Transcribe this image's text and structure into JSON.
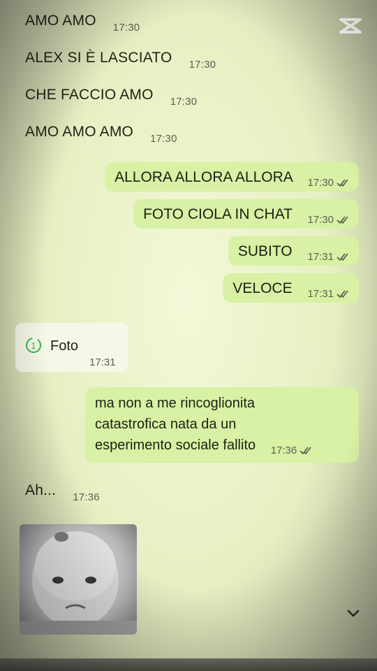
{
  "app": {
    "watermark_icon": "capcut-logo-icon"
  },
  "messages": [
    {
      "dir": "in",
      "text": "AMO AMO",
      "time": "17:30"
    },
    {
      "dir": "in",
      "text": "ALEX SI È LASCIATO",
      "time": "17:30"
    },
    {
      "dir": "in",
      "text": "CHE FACCIO AMO",
      "time": "17:30"
    },
    {
      "dir": "in",
      "text": "AMO AMO AMO",
      "time": "17:30"
    },
    {
      "dir": "out",
      "text": "ALLORA ALLORA ALLORA",
      "time": "17:30",
      "status": "read"
    },
    {
      "dir": "out",
      "text": "FOTO CIOLA IN CHAT",
      "time": "17:30",
      "status": "read"
    },
    {
      "dir": "out",
      "text": "SUBITO",
      "time": "17:31",
      "status": "read"
    },
    {
      "dir": "out",
      "text": "VELOCE",
      "time": "17:31",
      "status": "read"
    },
    {
      "dir": "in",
      "type": "view-once-photo",
      "badge": "1",
      "text": "Foto",
      "time": "17:31"
    },
    {
      "dir": "out",
      "lines": [
        "ma non a me rincoglionita",
        "catastrofica nata da un",
        "esperimento sociale fallito"
      ],
      "time": "17:36",
      "status": "read"
    },
    {
      "dir": "in",
      "text": "Ah...",
      "time": "17:36"
    },
    {
      "dir": "in",
      "type": "sticker",
      "icon": "baby-face-sticker"
    }
  ],
  "controls": {
    "scroll_down_icon": "chevron-down-icon"
  },
  "colors": {
    "outgoing_bubble": "#d8f1a4",
    "view_once_accent": "#3bb34a"
  }
}
